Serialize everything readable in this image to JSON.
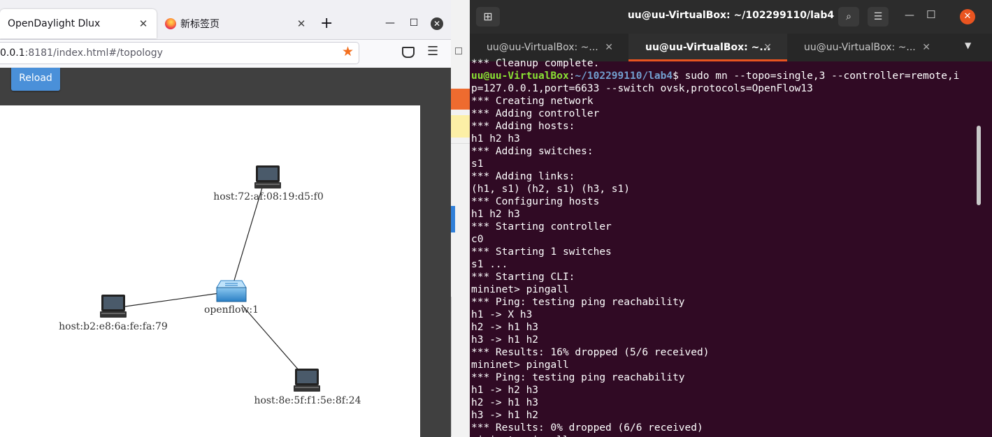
{
  "browser": {
    "tabs": [
      {
        "label": "OpenDaylight Dlux",
        "active": true
      },
      {
        "label": "新标签页",
        "active": false
      }
    ],
    "new_tab": "+",
    "url_host": "0.0.1",
    "url_path": ":8181/index.html#/topology",
    "reload_label": "Reload"
  },
  "topology": {
    "nodes": [
      {
        "label": "host:72:af:08:19:d5:f0",
        "type": "host"
      },
      {
        "label": "openflow:1",
        "type": "switch"
      },
      {
        "label": "host:b2:e8:6a:fe:fa:79",
        "type": "host"
      },
      {
        "label": "host:8e:5f:f1:5e:8f:24",
        "type": "host"
      }
    ],
    "links": [
      [
        "openflow:1",
        "host:72:af:08:19:d5:f0"
      ],
      [
        "openflow:1",
        "host:b2:e8:6a:fe:fa:79"
      ],
      [
        "openflow:1",
        "host:8e:5f:f1:5e:8f:24"
      ]
    ]
  },
  "terminal": {
    "title": "uu@uu-VirtualBox: ~/102299110/lab4",
    "tabs": [
      {
        "label": "uu@uu-VirtualBox: ~...",
        "active": false
      },
      {
        "label": "uu@uu-VirtualBox: ~...",
        "active": true
      },
      {
        "label": "uu@uu-VirtualBox: ~...",
        "active": false
      }
    ],
    "colors": {
      "background": "#300a24",
      "prompt_user": "#8ae234",
      "prompt_path": "#729fcf",
      "accent": "#e95420"
    },
    "prompt": {
      "user": "uu@uu-VirtualBox",
      "path": "~/102299110/lab4",
      "symbol": "$"
    },
    "first_line": "*** Cleanup complete.",
    "command_part1": " sudo mn --topo=single,3 --controller=remote,i",
    "command_part2": "p=127.0.0.1,port=6633 --switch ovsk,protocols=OpenFlow13",
    "output": [
      "*** Creating network",
      "*** Adding controller",
      "*** Adding hosts:",
      "h1 h2 h3",
      "*** Adding switches:",
      "s1",
      "*** Adding links:",
      "(h1, s1) (h2, s1) (h3, s1)",
      "*** Configuring hosts",
      "h1 h2 h3",
      "*** Starting controller",
      "c0",
      "*** Starting 1 switches",
      "s1 ...",
      "*** Starting CLI:",
      "mininet> pingall",
      "*** Ping: testing ping reachability",
      "h1 -> X h3",
      "h2 -> h1 h3",
      "h3 -> h1 h2",
      "*** Results: 16% dropped (5/6 received)",
      "mininet> pingall",
      "*** Ping: testing ping reachability",
      "h1 -> h2 h3",
      "h2 -> h1 h3",
      "h3 -> h1 h2",
      "*** Results: 0% dropped (6/6 received)",
      "mininet> pingall"
    ]
  }
}
